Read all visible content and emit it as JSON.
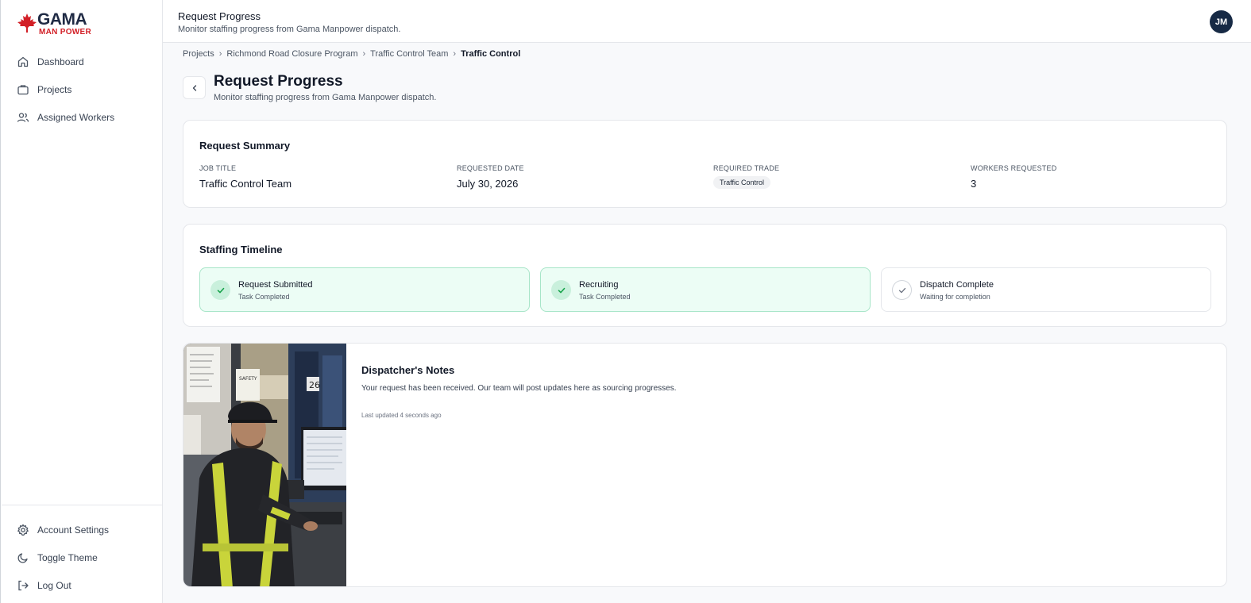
{
  "brand": {
    "name_top": "GAMA",
    "name_bottom": "MAN POWER",
    "leaf_color": "#d21f26"
  },
  "sidebar": {
    "top_items": [
      {
        "label": "Dashboard",
        "icon": "home-icon"
      },
      {
        "label": "Projects",
        "icon": "briefcase-icon"
      },
      {
        "label": "Assigned Workers",
        "icon": "users-icon"
      }
    ],
    "bottom_items": [
      {
        "label": "Account Settings",
        "icon": "gear-icon"
      },
      {
        "label": "Toggle Theme",
        "icon": "moon-icon"
      },
      {
        "label": "Log Out",
        "icon": "logout-icon"
      }
    ]
  },
  "header": {
    "title": "Request Progress",
    "subtitle": "Monitor staffing progress from Gama Manpower dispatch.",
    "avatar_initials": "JM",
    "avatar_color": "#172a45"
  },
  "breadcrumb": {
    "items": [
      "Projects",
      "Richmond Road Closure Program",
      "Traffic Control Team"
    ],
    "current": "Traffic Control"
  },
  "page": {
    "title": "Request Progress",
    "subtitle": "Monitor staffing progress from Gama Manpower dispatch."
  },
  "summary": {
    "title": "Request Summary",
    "fields": [
      {
        "label": "JOB TITLE",
        "value": "Traffic Control Team"
      },
      {
        "label": "REQUESTED DATE",
        "value": "July 30, 2026"
      },
      {
        "label": "REQUIRED TRADE",
        "value": "Traffic Control"
      },
      {
        "label": "WORKERS REQUESTED",
        "value": "3"
      }
    ]
  },
  "timeline": {
    "title": "Staffing Timeline",
    "steps": [
      {
        "title": "Request Submitted",
        "status": "Task Completed",
        "done": true
      },
      {
        "title": "Recruiting",
        "status": "Task Completed",
        "done": true
      },
      {
        "title": "Dispatch Complete",
        "status": "Waiting for completion",
        "done": false
      }
    ],
    "done_color": "#ecfdf5"
  },
  "notes": {
    "title": "Dispatcher's Notes",
    "body": "Your request has been received. Our team will post updates here as sourcing progresses.",
    "updated": "Last updated 4 seconds ago",
    "image": "dispatcher-photo"
  }
}
